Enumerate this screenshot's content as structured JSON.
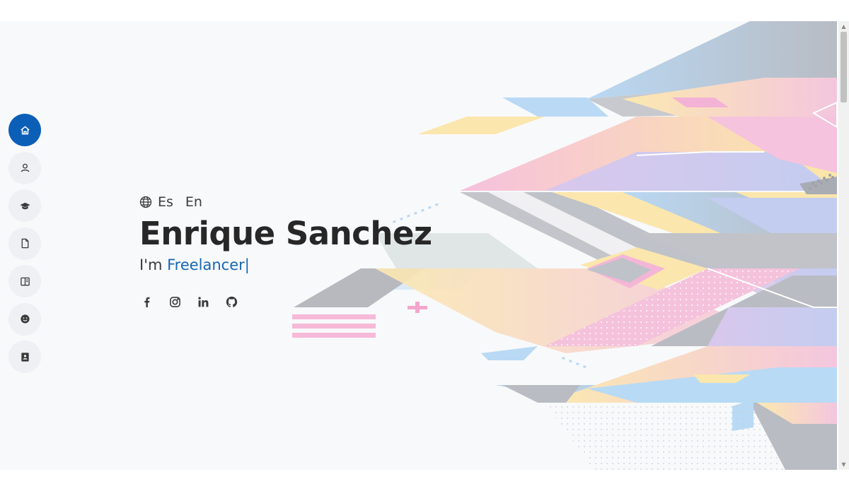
{
  "nav": {
    "items": [
      {
        "icon": "home-icon",
        "active": true
      },
      {
        "icon": "user-icon",
        "active": false
      },
      {
        "icon": "graduation-cap-icon",
        "active": false
      },
      {
        "icon": "file-icon",
        "active": false
      },
      {
        "icon": "book-icon",
        "active": false
      },
      {
        "icon": "smile-icon",
        "active": false
      },
      {
        "icon": "contact-book-icon",
        "active": false
      }
    ]
  },
  "hero": {
    "lang_icon": "globe-icon",
    "lang_es": "Es",
    "lang_en": "En",
    "name": "Enrique Sanchez",
    "role_prefix": "I'm ",
    "role_typed": "Freelancer",
    "cursor": "|"
  },
  "social": [
    {
      "icon": "facebook-icon"
    },
    {
      "icon": "instagram-icon"
    },
    {
      "icon": "linkedin-icon"
    },
    {
      "icon": "github-icon"
    }
  ],
  "colors": {
    "accent": "#0b5fb7",
    "typed_text": "#1566b4",
    "heading": "#272727",
    "page_bg": "#f8f9fb"
  }
}
